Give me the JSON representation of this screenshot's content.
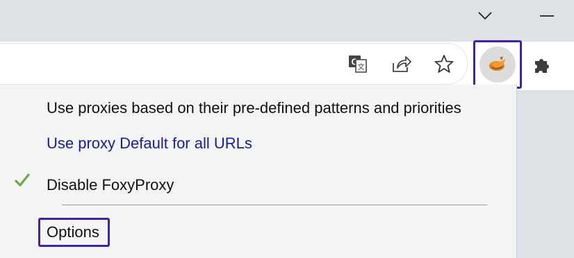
{
  "icons": {
    "chevron": "chevron-down-icon",
    "minimize": "minimize-icon",
    "translate": "translate-icon",
    "share": "share-icon",
    "star": "star-icon",
    "extension": "foxyproxy-icon",
    "puzzle": "puzzle-icon",
    "check": "check-icon"
  },
  "colors": {
    "highlight": "#3f22a8",
    "link": "#1b1b9e",
    "check": "#6aa84f"
  },
  "menu": {
    "items": [
      {
        "label": "Use proxies based on their pre-defined patterns and priorities"
      },
      {
        "label": "Use proxy Default for all URLs"
      },
      {
        "label": "Disable FoxyProxy",
        "checked": true
      }
    ],
    "options_label": "Options"
  }
}
